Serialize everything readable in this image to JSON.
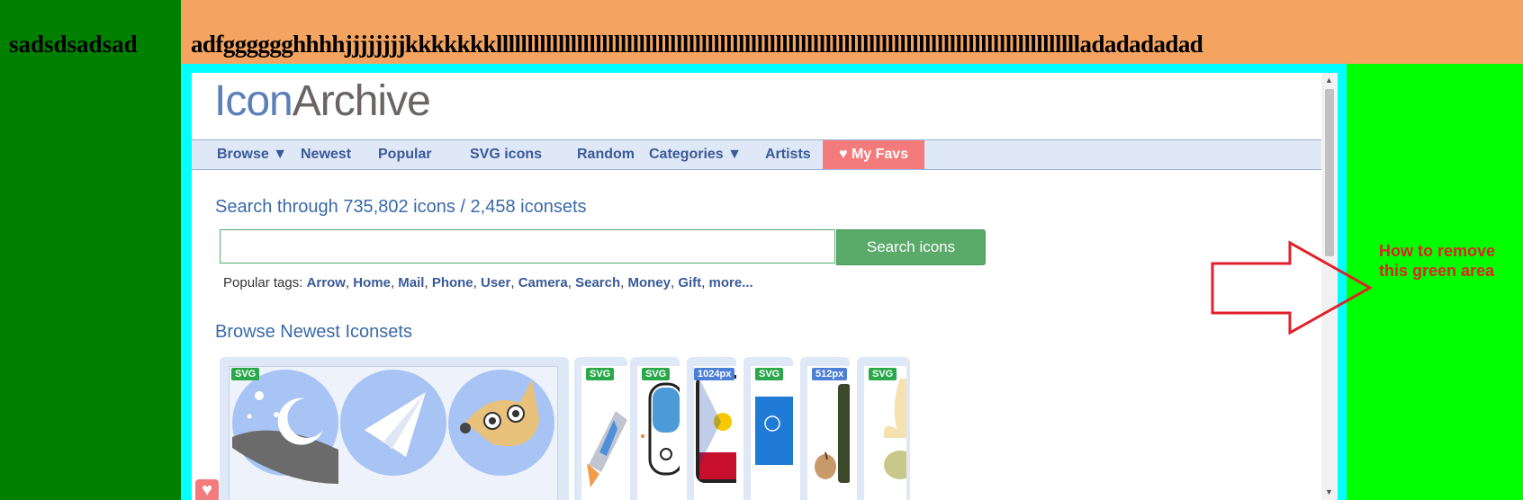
{
  "left_column": {
    "text": "sadsdsadsad"
  },
  "header": {
    "text": "adfgggggghhhhjjjjjjjjkkkkkkklllllllllllllllllllllllllllllllllllllllllllllllllllllllllllllllllllllllllllllllllllllllllllllladadadadad"
  },
  "site": {
    "logo": {
      "part1": "Icon",
      "part2": "Archive"
    },
    "nav": {
      "items": [
        "Browse ▼",
        "Newest",
        "Popular",
        "SVG icons",
        "Random",
        "Categories ▼",
        "Artists"
      ],
      "favs": "♥ My Favs"
    },
    "search": {
      "heading": "Search through 735,802 icons / 2,458 iconsets",
      "input_value": "",
      "button": "Search icons",
      "popular_label": "Popular tags: ",
      "tags": [
        "Arrow",
        "Home",
        "Mail",
        "Phone",
        "User",
        "Camera",
        "Search",
        "Money",
        "Gift",
        "more..."
      ]
    },
    "newest": {
      "heading": "Browse Newest Iconsets",
      "badges": [
        "SVG",
        "SVG",
        "SVG",
        "1024px",
        "SVG",
        "512px",
        "SVG"
      ]
    }
  },
  "annotation": {
    "line1": "How to remove",
    "line2": "this green area"
  },
  "colors": {
    "left_green": "#008000",
    "right_green": "#00ff00",
    "header_orange": "#f4a460",
    "frame_cyan": "#00ffff",
    "nav_bg": "#dfe8f7",
    "favs_bg": "#f37b7b",
    "search_green": "#5aaa6a",
    "annotation_red": "#e0202a"
  }
}
